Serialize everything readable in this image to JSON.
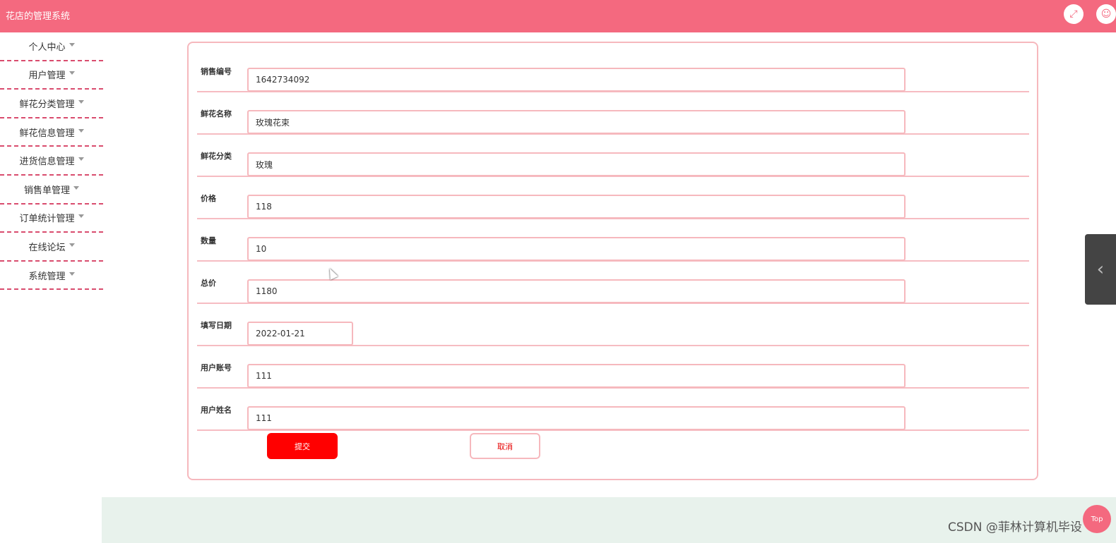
{
  "header": {
    "title": "花店的管理系统",
    "fullscreen_icon": "⤢",
    "user_icon": "☺"
  },
  "sidebar": {
    "items": [
      {
        "label": "个人中心"
      },
      {
        "label": "用户管理"
      },
      {
        "label": "鲜花分类管理"
      },
      {
        "label": "鲜花信息管理"
      },
      {
        "label": "进货信息管理"
      },
      {
        "label": "销售单管理"
      },
      {
        "label": "订单统计管理"
      },
      {
        "label": "在线论坛"
      },
      {
        "label": "系统管理"
      }
    ]
  },
  "form": {
    "fields": [
      {
        "label": "销售编号",
        "value": "1642734092"
      },
      {
        "label": "鲜花名称",
        "value": "玫瑰花束"
      },
      {
        "label": "鲜花分类",
        "value": "玫瑰"
      },
      {
        "label": "价格",
        "value": "118"
      },
      {
        "label": "数量",
        "value": "10"
      },
      {
        "label": "总价",
        "value": "1180"
      },
      {
        "label": "填写日期",
        "value": "2022-01-21"
      },
      {
        "label": "用户账号",
        "value": "111"
      },
      {
        "label": "用户姓名",
        "value": "111"
      }
    ],
    "submit_label": "提交",
    "cancel_label": "取消"
  },
  "side_handle": {
    "icon": "‹"
  },
  "back_to_top": {
    "label": "Top"
  },
  "watermark": "CSDN @菲林计算机毕设",
  "colors": {
    "header": "#f4697f",
    "submit": "#ff0000",
    "border": "#f6b8bd",
    "menu_divider": "#d94c6e",
    "footer": "#e8f2ec"
  }
}
